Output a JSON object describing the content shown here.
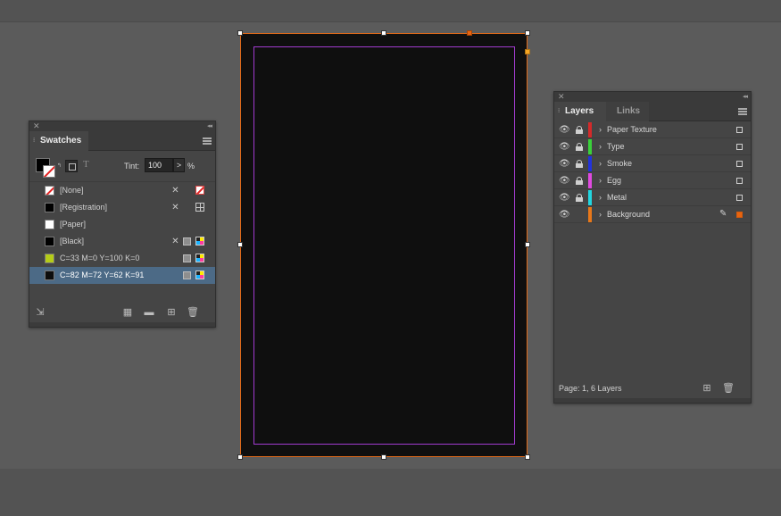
{
  "swatches_panel": {
    "tab_label": "Swatches",
    "tint_label": "Tint:",
    "tint_value": "100",
    "tint_arrow": ">",
    "tint_unit": "%",
    "text_toggle": "T",
    "items": [
      {
        "name": "[None]",
        "chip_color": "none"
      },
      {
        "name": "[Registration]",
        "chip_color": "#000000"
      },
      {
        "name": "[Paper]",
        "chip_color": "#ffffff"
      },
      {
        "name": "[Black]",
        "chip_color": "#000000"
      },
      {
        "name": "C=33 M=0 Y=100 K=0",
        "chip_color": "#b5cc18"
      },
      {
        "name": "C=82 M=72 Y=62 K=91",
        "chip_color": "#0d0d0d",
        "selected": true
      }
    ]
  },
  "layers_panel": {
    "tab_active": "Layers",
    "tab_inactive": "Links",
    "status_text": "Page: 1, 6 Layers",
    "layers": [
      {
        "name": "Paper Texture",
        "color": "#d42a2a",
        "locked": true
      },
      {
        "name": "Type",
        "color": "#3ad13a",
        "locked": true
      },
      {
        "name": "Smoke",
        "color": "#2233dd",
        "locked": true
      },
      {
        "name": "Egg",
        "color": "#e04ae0",
        "locked": true
      },
      {
        "name": "Metal",
        "color": "#22d6e0",
        "locked": true
      },
      {
        "name": "Background",
        "color": "#e8781a",
        "locked": false,
        "active": true
      }
    ]
  },
  "document": {
    "page_color": "#0f0f0f",
    "bleed_color": "#e06a1a",
    "margin_color": "#a23bd0"
  }
}
